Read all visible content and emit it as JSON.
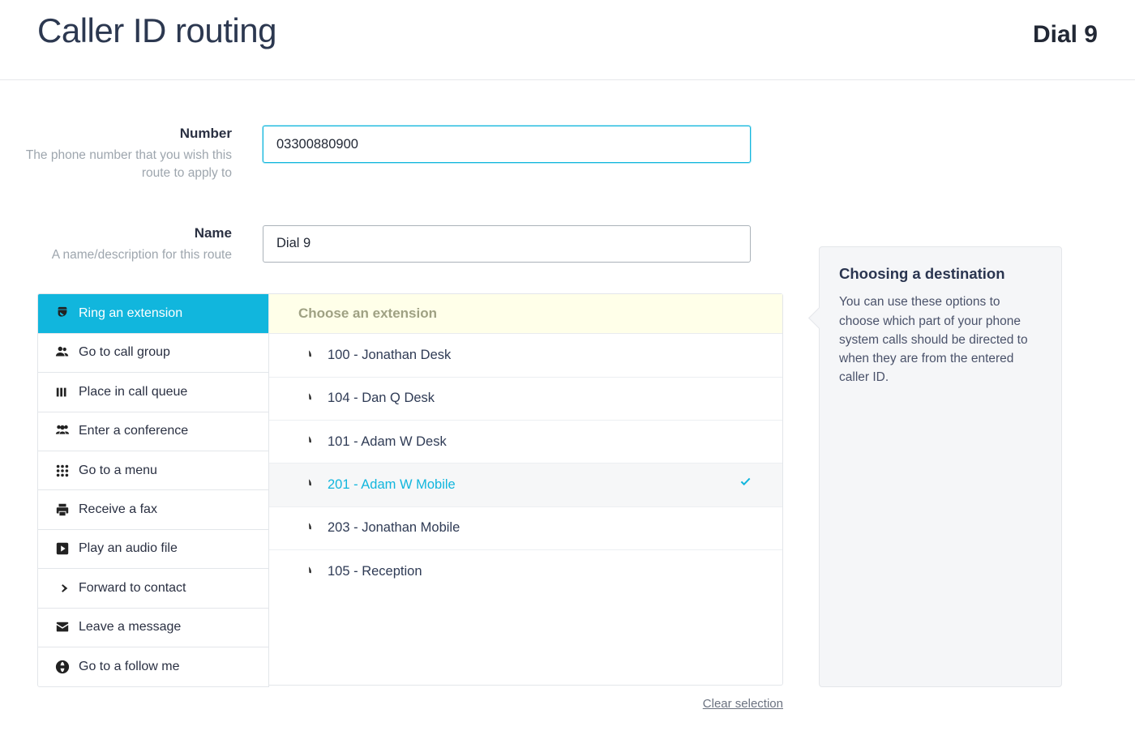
{
  "header": {
    "title": "Caller ID routing",
    "brand": "Dial 9"
  },
  "form": {
    "number": {
      "label": "Number",
      "hint": "The phone number that you wish this route to apply to",
      "value": "03300880900"
    },
    "name": {
      "label": "Name",
      "hint": "A name/description for this route",
      "value": "Dial 9"
    }
  },
  "destinations": {
    "items": [
      {
        "label": "Ring an extension",
        "icon": "phone-icon",
        "active": true
      },
      {
        "label": "Go to call group",
        "icon": "group-icon",
        "active": false
      },
      {
        "label": "Place in call queue",
        "icon": "queue-icon",
        "active": false
      },
      {
        "label": "Enter a conference",
        "icon": "conference-icon",
        "active": false
      },
      {
        "label": "Go to a menu",
        "icon": "menu-icon",
        "active": false
      },
      {
        "label": "Receive a fax",
        "icon": "fax-icon",
        "active": false
      },
      {
        "label": "Play an audio file",
        "icon": "play-icon",
        "active": false
      },
      {
        "label": "Forward to contact",
        "icon": "forward-icon",
        "active": false
      },
      {
        "label": "Leave a message",
        "icon": "message-icon",
        "active": false
      },
      {
        "label": "Go to a follow me",
        "icon": "globe-icon",
        "active": false
      }
    ]
  },
  "extensions": {
    "header": "Choose an extension",
    "items": [
      {
        "label": "100 - Jonathan Desk",
        "selected": false
      },
      {
        "label": "104 - Dan Q Desk",
        "selected": false
      },
      {
        "label": "101 - Adam W Desk",
        "selected": false
      },
      {
        "label": "201 - Adam W Mobile",
        "selected": true
      },
      {
        "label": "203 - Jonathan Mobile",
        "selected": false
      },
      {
        "label": "105 - Reception",
        "selected": false
      }
    ],
    "clear": "Clear selection"
  },
  "help": {
    "title": "Choosing a destination",
    "body": "You can use these options to choose which part of your phone system calls should be directed to when they are from the entered caller ID."
  }
}
